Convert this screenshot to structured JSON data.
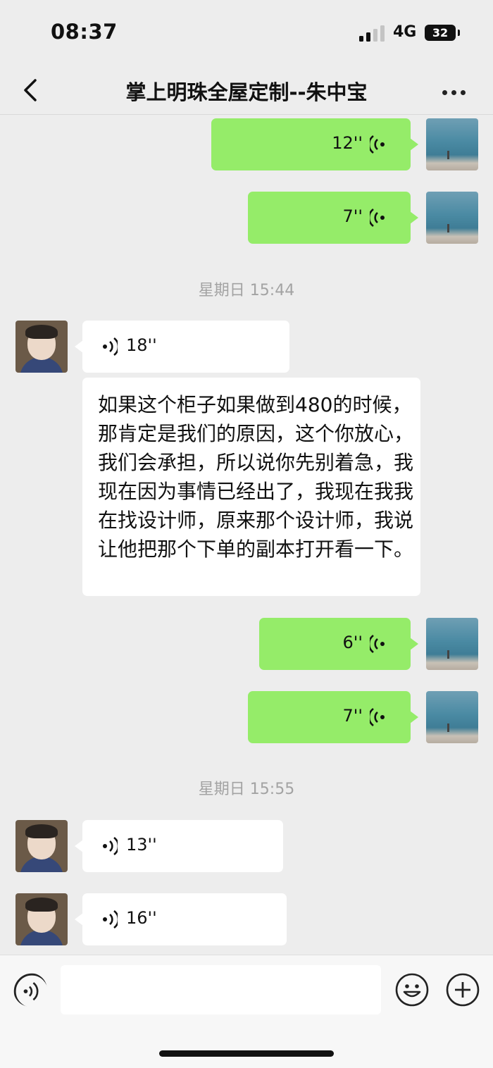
{
  "status_bar": {
    "time": "08:37",
    "network": "4G",
    "battery": "32"
  },
  "header": {
    "title": "掌上明珠全屋定制--朱中宝"
  },
  "messages": [
    {
      "duration": "12''"
    },
    {
      "duration": "7''"
    },
    {
      "timestamp": "星期日 15:44"
    },
    {
      "duration": "18''"
    },
    {
      "text": "如果这个柜子如果做到480的时候，那肯定是我们的原因，这个你放心，我们会承担，所以说你先别着急，我现在因为事情已经出了，我现在我我在找设计师，原来那个设计师，我说让他把那个下单的副本打开看一下。"
    },
    {
      "duration": "6''"
    },
    {
      "duration": "7''"
    },
    {
      "timestamp": "星期日 15:55"
    },
    {
      "duration": "13''"
    },
    {
      "duration": "16''"
    }
  ],
  "colors": {
    "bubble_self": "#95ec69",
    "bubble_other": "#ffffff",
    "background": "#ededed"
  },
  "icons": [
    "chevron-left-icon",
    "more-dots-icon",
    "voice-wave-icon",
    "voice-input-icon",
    "emoji-icon",
    "plus-icon"
  ]
}
